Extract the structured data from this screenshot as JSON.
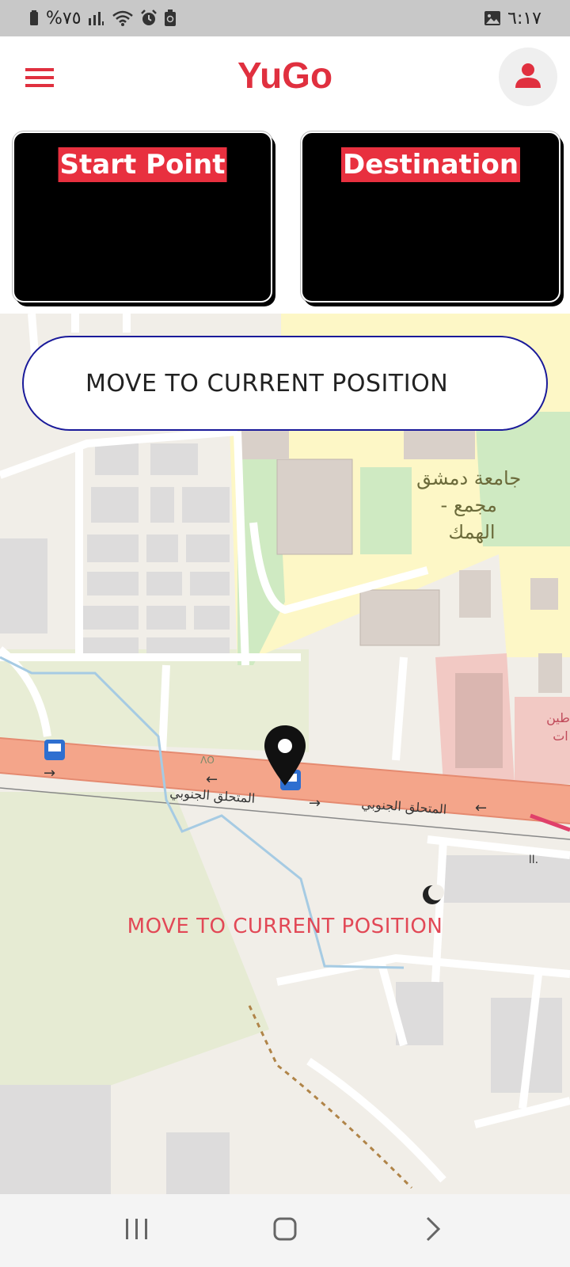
{
  "status_bar": {
    "battery_text": "%٧٥",
    "time": "٦:١٧"
  },
  "app_bar": {
    "title": "YuGo",
    "menu_icon": "hamburger-menu-icon",
    "profile_icon": "person-icon"
  },
  "cards": {
    "start_label": "Start Point",
    "destination_label": "Destination"
  },
  "map": {
    "move_button_label": "MOVE TO CURRENT POSITION",
    "overlay_text": "MOVE TO CURRENT POSITION",
    "labels": {
      "university": "جامعة دمشق - مجمع الهمك",
      "road_1": "المتحلق الجنوبي",
      "road_2": "المتحلق الجنوبي",
      "partial_1": "طين",
      "partial_2": "ات",
      "stop_number": "ΛΟ",
      "shop": "ا",
      "small": "اا."
    }
  },
  "colors": {
    "accent": "#e0303f",
    "card_bg": "#000000",
    "button_border": "#1a1a9a",
    "road": "#f4a58a",
    "park": "#cfeac2",
    "campus": "#fdf7c6"
  }
}
